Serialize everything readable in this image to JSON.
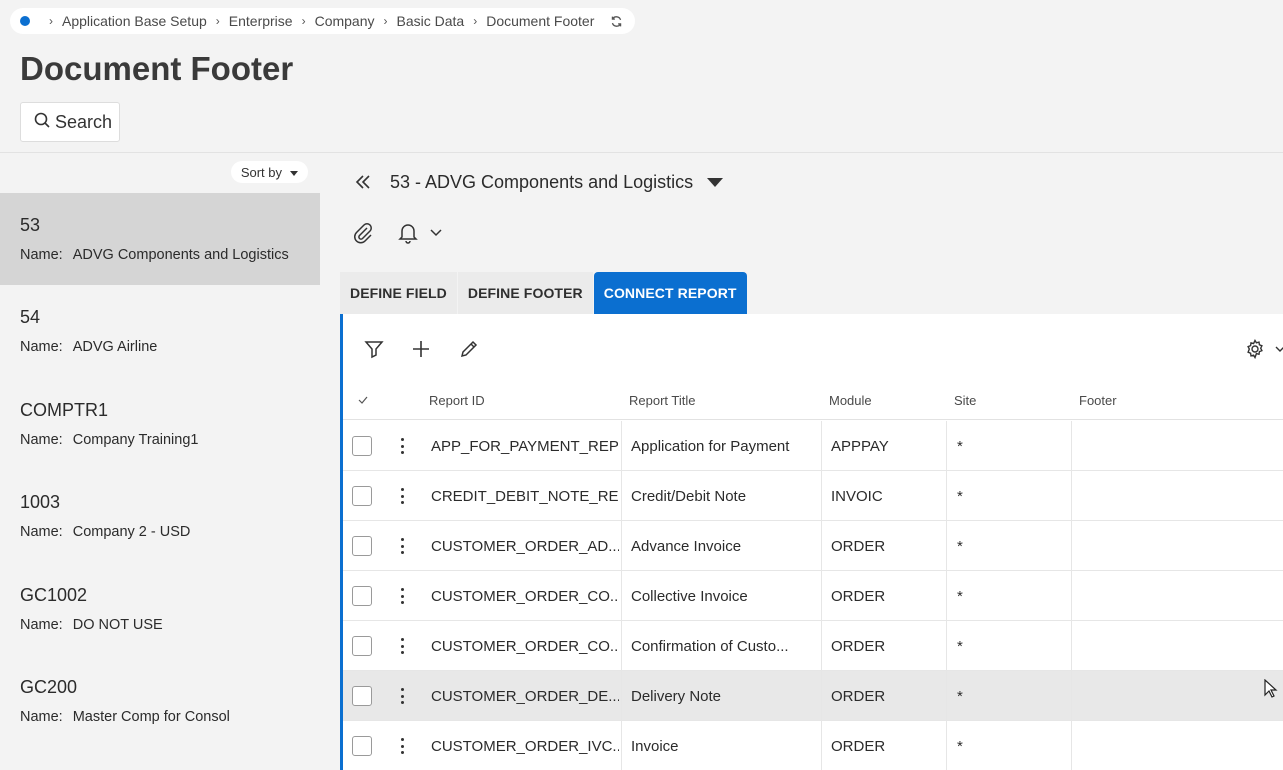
{
  "breadcrumb": {
    "items": [
      "Application Base Setup",
      "Enterprise",
      "Company",
      "Basic Data",
      "Document Footer"
    ]
  },
  "page": {
    "title": "Document Footer"
  },
  "search": {
    "label": "Search"
  },
  "list": {
    "sort_label": "Sort by",
    "name_label": "Name:",
    "items": [
      {
        "id": "53",
        "name": "ADVG Components and Logistics"
      },
      {
        "id": "54",
        "name": "ADVG Airline"
      },
      {
        "id": "COMPTR1",
        "name": "Company Training1"
      },
      {
        "id": "1003",
        "name": "Company 2 - USD"
      },
      {
        "id": "GC1002",
        "name": "DO NOT USE"
      },
      {
        "id": "GC200",
        "name": "Master Comp for Consol"
      }
    ]
  },
  "record": {
    "title": "53 - ADVG Components and Logistics"
  },
  "tabs": [
    {
      "label": "DEFINE FIELD"
    },
    {
      "label": "DEFINE FOOTER"
    },
    {
      "label": "CONNECT REPORT"
    }
  ],
  "grid": {
    "columns": [
      "Report ID",
      "Report Title",
      "Module",
      "Site",
      "Footer"
    ],
    "rows": [
      {
        "report_id": "APP_FOR_PAYMENT_REP",
        "title": "Application for Payment",
        "module": "APPPAY",
        "site": "*",
        "footer": ""
      },
      {
        "report_id": "CREDIT_DEBIT_NOTE_REP",
        "title": "Credit/Debit Note",
        "module": "INVOIC",
        "site": "*",
        "footer": ""
      },
      {
        "report_id": "CUSTOMER_ORDER_AD...",
        "title": "Advance Invoice",
        "module": "ORDER",
        "site": "*",
        "footer": ""
      },
      {
        "report_id": "CUSTOMER_ORDER_CO...",
        "title": "Collective Invoice",
        "module": "ORDER",
        "site": "*",
        "footer": ""
      },
      {
        "report_id": "CUSTOMER_ORDER_CO...",
        "title": "Confirmation of Custo...",
        "module": "ORDER",
        "site": "*",
        "footer": ""
      },
      {
        "report_id": "CUSTOMER_ORDER_DE...",
        "title": "Delivery Note",
        "module": "ORDER",
        "site": "*",
        "footer": ""
      },
      {
        "report_id": "CUSTOMER_ORDER_IVC...",
        "title": "Invoice",
        "module": "ORDER",
        "site": "*",
        "footer": ""
      }
    ]
  },
  "colors": {
    "accent": "#0b6fd0",
    "selected_item": "#d5d5d5",
    "page_bg": "#f3f3f3"
  }
}
